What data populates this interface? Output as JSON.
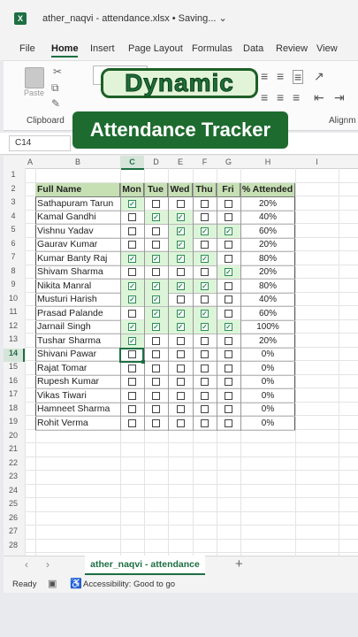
{
  "window": {
    "title": "ather_naqvi - attendance.xlsx  •  Saving... ⌄"
  },
  "menu": [
    "File",
    "Home",
    "Insert",
    "Page Layout",
    "Formulas",
    "Data",
    "Review",
    "View"
  ],
  "ribbon": {
    "paste_label": "Paste",
    "clipboard_group": "Clipboard",
    "alignment_group": "Alignm"
  },
  "overlay": {
    "line1": "Dynamic",
    "line2": "Attendance Tracker"
  },
  "name_box": "C14",
  "columns": [
    "A",
    "B",
    "C",
    "D",
    "E",
    "F",
    "G",
    "H",
    "I"
  ],
  "rows": [
    "1",
    "2",
    "3",
    "4",
    "5",
    "6",
    "7",
    "8",
    "9",
    "10",
    "11",
    "12",
    "13",
    "14",
    "15",
    "16",
    "17",
    "18",
    "19",
    "20",
    "21",
    "22",
    "23",
    "24",
    "25",
    "26",
    "27",
    "28"
  ],
  "table": {
    "headers": [
      "Full Name",
      "Mon",
      "Tue",
      "Wed",
      "Thu",
      "Fri",
      "% Attended"
    ],
    "records": [
      {
        "name": "Sathapuram Tarun",
        "days": [
          1,
          0,
          0,
          0,
          0
        ],
        "pct": "20%"
      },
      {
        "name": "Kamal Gandhi",
        "days": [
          0,
          1,
          1,
          0,
          0
        ],
        "pct": "40%"
      },
      {
        "name": "Vishnu Yadav",
        "days": [
          0,
          0,
          1,
          1,
          1
        ],
        "pct": "60%"
      },
      {
        "name": "Gaurav Kumar",
        "days": [
          0,
          0,
          1,
          0,
          0
        ],
        "pct": "20%"
      },
      {
        "name": "Kumar Banty Raj",
        "days": [
          1,
          1,
          1,
          1,
          0
        ],
        "pct": "80%"
      },
      {
        "name": "Shivam Sharma",
        "days": [
          0,
          0,
          0,
          0,
          1
        ],
        "pct": "20%"
      },
      {
        "name": "Nikita Manral",
        "days": [
          1,
          1,
          1,
          1,
          0
        ],
        "pct": "80%"
      },
      {
        "name": "Musturi Harish",
        "days": [
          1,
          1,
          0,
          0,
          0
        ],
        "pct": "40%"
      },
      {
        "name": "Prasad Palande",
        "days": [
          0,
          1,
          1,
          1,
          0
        ],
        "pct": "60%"
      },
      {
        "name": "Jarnail Singh",
        "days": [
          1,
          1,
          1,
          1,
          1
        ],
        "pct": "100%"
      },
      {
        "name": "Tushar Sharma",
        "days": [
          1,
          0,
          0,
          0,
          0
        ],
        "pct": "20%"
      },
      {
        "name": "Shivani Pawar",
        "days": [
          0,
          0,
          0,
          0,
          0
        ],
        "pct": "0%"
      },
      {
        "name": "Rajat Tomar",
        "days": [
          0,
          0,
          0,
          0,
          0
        ],
        "pct": "0%"
      },
      {
        "name": "Rupesh Kumar",
        "days": [
          0,
          0,
          0,
          0,
          0
        ],
        "pct": "0%"
      },
      {
        "name": "Vikas Tiwari",
        "days": [
          0,
          0,
          0,
          0,
          0
        ],
        "pct": "0%"
      },
      {
        "name": "Hamneet Sharma",
        "days": [
          0,
          0,
          0,
          0,
          0
        ],
        "pct": "0%"
      },
      {
        "name": "Rohit Verma",
        "days": [
          0,
          0,
          0,
          0,
          0
        ],
        "pct": "0%"
      }
    ]
  },
  "sheet_tab": "ather_naqvi - attendance",
  "status": {
    "ready": "Ready",
    "accessibility": "Accessibility: Good to go"
  },
  "colors": {
    "accent": "#1d6f42",
    "header_fill": "#c6e0b4",
    "checked_fill": "#dcf5d8"
  }
}
